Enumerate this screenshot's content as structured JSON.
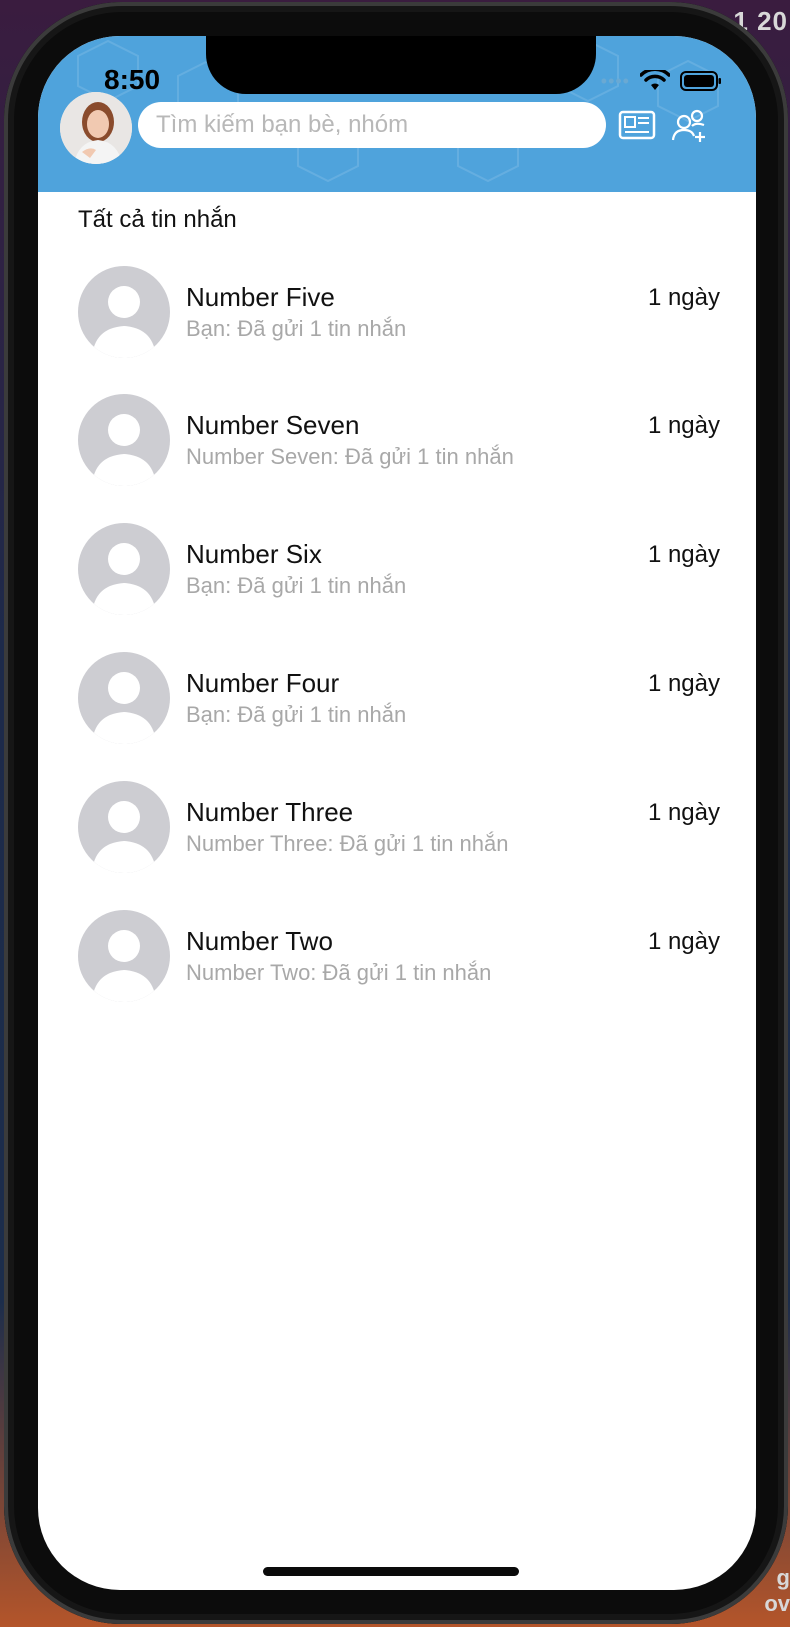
{
  "status_bar": {
    "time": "8:50"
  },
  "header": {
    "search_placeholder": "Tìm kiếm bạn bè, nhóm"
  },
  "section_title": "Tất cả tin nhắn",
  "conversations": [
    {
      "name": "Number Five",
      "preview": "Bạn: Đã gửi 1 tin nhắn",
      "time": "1 ngày"
    },
    {
      "name": "Number Seven",
      "preview": "Number Seven: Đã gửi 1 tin nhắn",
      "time": "1 ngày"
    },
    {
      "name": "Number Six",
      "preview": "Bạn: Đã gửi 1 tin nhắn",
      "time": "1 ngày"
    },
    {
      "name": "Number Four",
      "preview": "Bạn: Đã gửi 1 tin nhắn",
      "time": "1 ngày"
    },
    {
      "name": "Number Three",
      "preview": "Number Three: Đã gửi 1 tin nhắn",
      "time": "1 ngày"
    },
    {
      "name": "Number Two",
      "preview": "Number Two: Đã gửi 1 tin nhắn",
      "time": "1 ngày"
    }
  ],
  "colors": {
    "header_blue": "#4fa3dc",
    "avatar_gray": "#cdcdd2",
    "preview_gray": "#a8a8a8"
  },
  "icons": {
    "news": "newspaper-icon",
    "add_friend": "add-friend-icon",
    "wifi": "wifi-icon",
    "battery": "battery-icon"
  },
  "desktop_corner_text": {
    "top": "1 20",
    "bottom_line1": "g",
    "bottom_line2": "ov"
  }
}
